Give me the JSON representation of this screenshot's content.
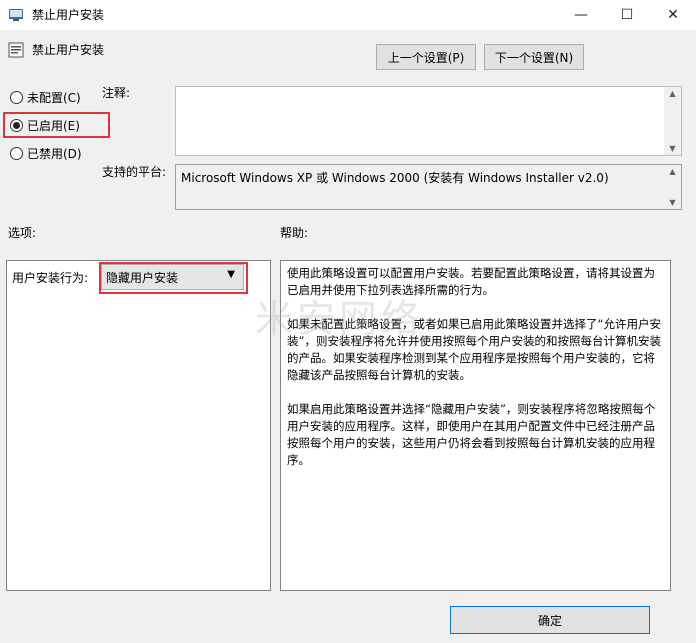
{
  "window": {
    "title": "禁止用户安装",
    "minimize_glyph": "—",
    "maximize_glyph": "☐",
    "close_glyph": "✕"
  },
  "header": {
    "policy_name": "禁止用户安装",
    "prev_button": "上一个设置(P)",
    "next_button": "下一个设置(N)"
  },
  "state_options": {
    "not_configured": "未配置(C)",
    "enabled": "已启用(E)",
    "disabled": "已禁用(D)",
    "selected": "enabled"
  },
  "comment": {
    "label": "注释:",
    "value": ""
  },
  "platform": {
    "label": "支持的平台:",
    "value": "Microsoft Windows XP 或 Windows 2000 (安装有 Windows Installer v2.0)"
  },
  "options": {
    "label": "选项:",
    "behavior_label": "用户安装行为:",
    "behavior_value": "隐藏用户安装"
  },
  "help": {
    "label": "帮助:",
    "text": "使用此策略设置可以配置用户安装。若要配置此策略设置，请将其设置为已启用并使用下拉列表选择所需的行为。\n\n如果未配置此策略设置，或者如果已启用此策略设置并选择了“允许用户安装”，则安装程序将允许并使用按照每个用户安装的和按照每台计算机安装的产品。如果安装程序检测到某个应用程序是按照每个用户安装的，它将隐藏该产品按照每台计算机的安装。\n\n如果启用此策略设置并选择“隐藏用户安装”，则安装程序将忽略按照每个用户安装的应用程序。这样，即使用户在其用户配置文件中已经注册产品按照每个用户的安装，这些用户仍将会看到按照每台计算机安装的应用程序。"
  },
  "footer": {
    "ok_button": "确定"
  },
  "watermark": {
    "text": "米安网络"
  }
}
